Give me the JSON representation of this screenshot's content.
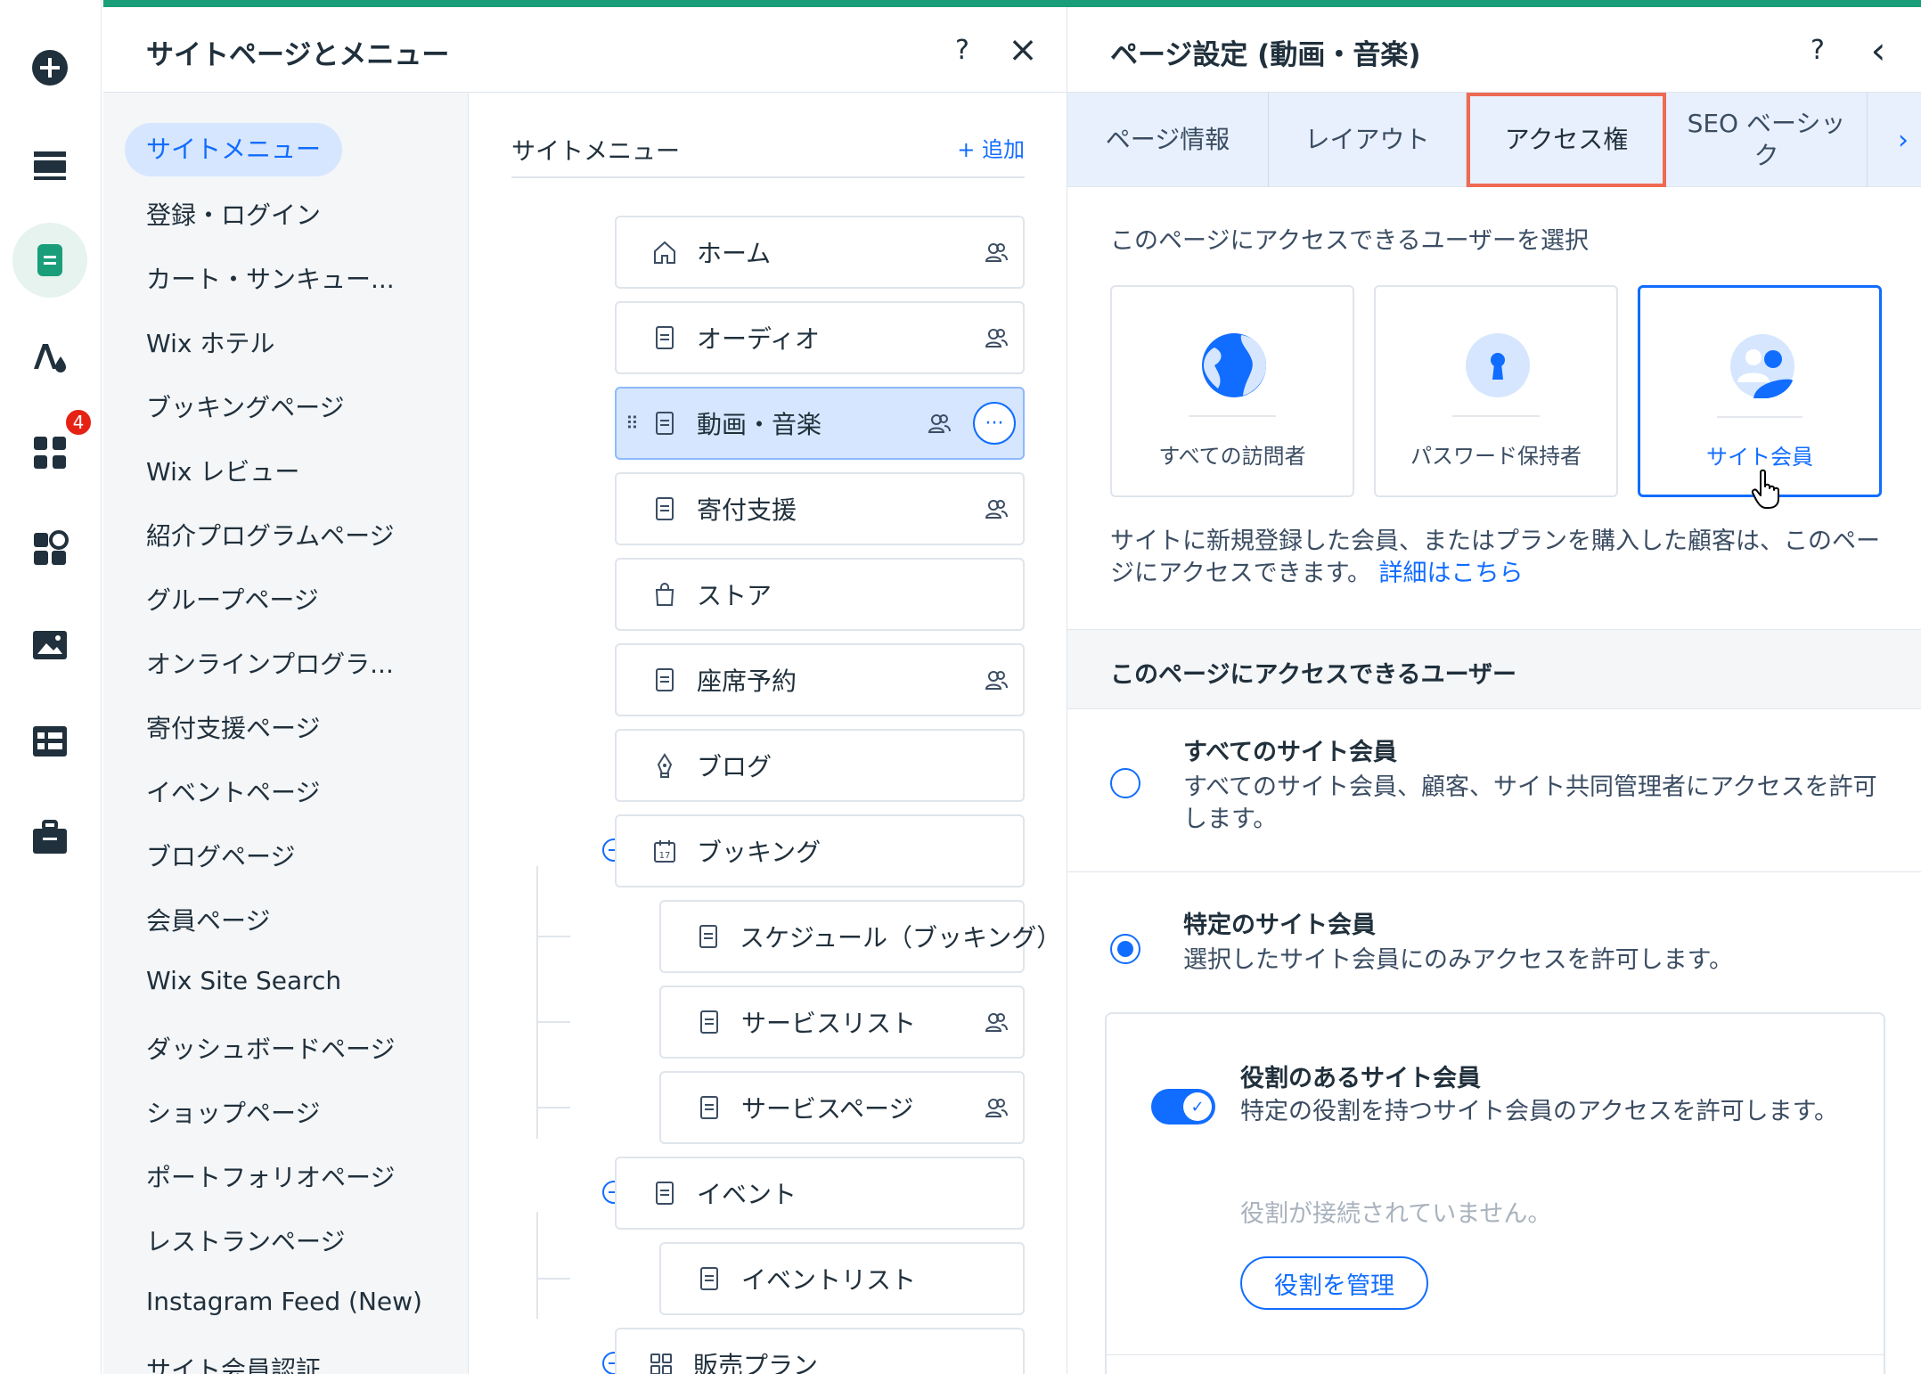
{
  "left_panel": {
    "title": "サイトページとメニュー",
    "help_icon": "?",
    "close_icon": "×",
    "categories": [
      "サイトメニュー",
      "登録・ログイン",
      "カート・サンキュー...",
      "Wix ホテル",
      "ブッキングページ",
      "Wix レビュー",
      "紹介プログラムページ",
      "グループページ",
      "オンラインプログラ...",
      "寄付支援ページ",
      "イベントページ",
      "ブログページ",
      "会員ページ",
      "Wix Site Search",
      "ダッシュボードページ",
      "ショップページ",
      "ポートフォリオページ",
      "レストランページ",
      "Instagram Feed (New)",
      "サイト会員認証"
    ],
    "menu": {
      "heading": "サイトメニュー",
      "add_label": "+ 追加",
      "pages": [
        {
          "label": "ホーム",
          "icon": "home-icon"
        },
        {
          "label": "オーディオ",
          "icon": "page-icon"
        },
        {
          "label": "動画・音楽",
          "icon": "page-icon"
        },
        {
          "label": "寄付支援",
          "icon": "page-icon"
        },
        {
          "label": "ストア",
          "icon": "bag-icon"
        },
        {
          "label": "座席予約",
          "icon": "page-icon"
        },
        {
          "label": "ブログ",
          "icon": "pen-icon"
        },
        {
          "label": "ブッキング",
          "icon": "calendar-icon",
          "calendar_day": "17"
        },
        {
          "label": "スケジュール（ブッキング）",
          "icon": "page-icon"
        },
        {
          "label": "サービスリスト",
          "icon": "page-icon"
        },
        {
          "label": "サービスページ",
          "icon": "page-icon"
        },
        {
          "label": "イベント",
          "icon": "page-icon"
        },
        {
          "label": "イベントリスト",
          "icon": "page-icon"
        },
        {
          "label": "販売プラン",
          "icon": "grid-icon"
        }
      ],
      "more_icon": "···",
      "drag_icon": "⠿"
    }
  },
  "rail": {
    "badge_count": "4"
  },
  "right_panel": {
    "title": "ページ設定 (動画・音楽)",
    "help_icon": "?",
    "back_icon": "‹",
    "tabs": [
      "ページ情報",
      "レイアウト",
      "アクセス権",
      "SEO ベーシック"
    ],
    "tab_next_icon": "›",
    "choose_label": "このページにアクセスできるユーザーを選択",
    "access_options": [
      "すべての訪問者",
      "パスワード保持者",
      "サイト会員"
    ],
    "description": "サイトに新規登録した会員、またはプランを購入した顧客は、このページにアクセスできます。",
    "learn_more": "詳細はこちら",
    "who_header": "このページにアクセスできるユーザー",
    "all_members": {
      "title": "すべてのサイト会員",
      "desc": "すべてのサイト会員、顧客、サイト共同管理者にアクセスを許可します。"
    },
    "specific_members": {
      "title": "特定のサイト会員",
      "desc": "選択したサイト会員にのみアクセスを許可します。"
    },
    "roles": {
      "title": "役割のあるサイト会員",
      "desc": "特定の役割を持つサイト会員のアクセスを許可します。",
      "empty": "役割が接続されていません。",
      "button": "役割を管理",
      "toggle_check": "✓"
    }
  },
  "colors": {
    "accent": "#116dff",
    "selected_bg": "#d6e6fe",
    "tab_highlight": "#ee6a52",
    "top_line": "#1a9e7a",
    "badge": "#e62214"
  }
}
